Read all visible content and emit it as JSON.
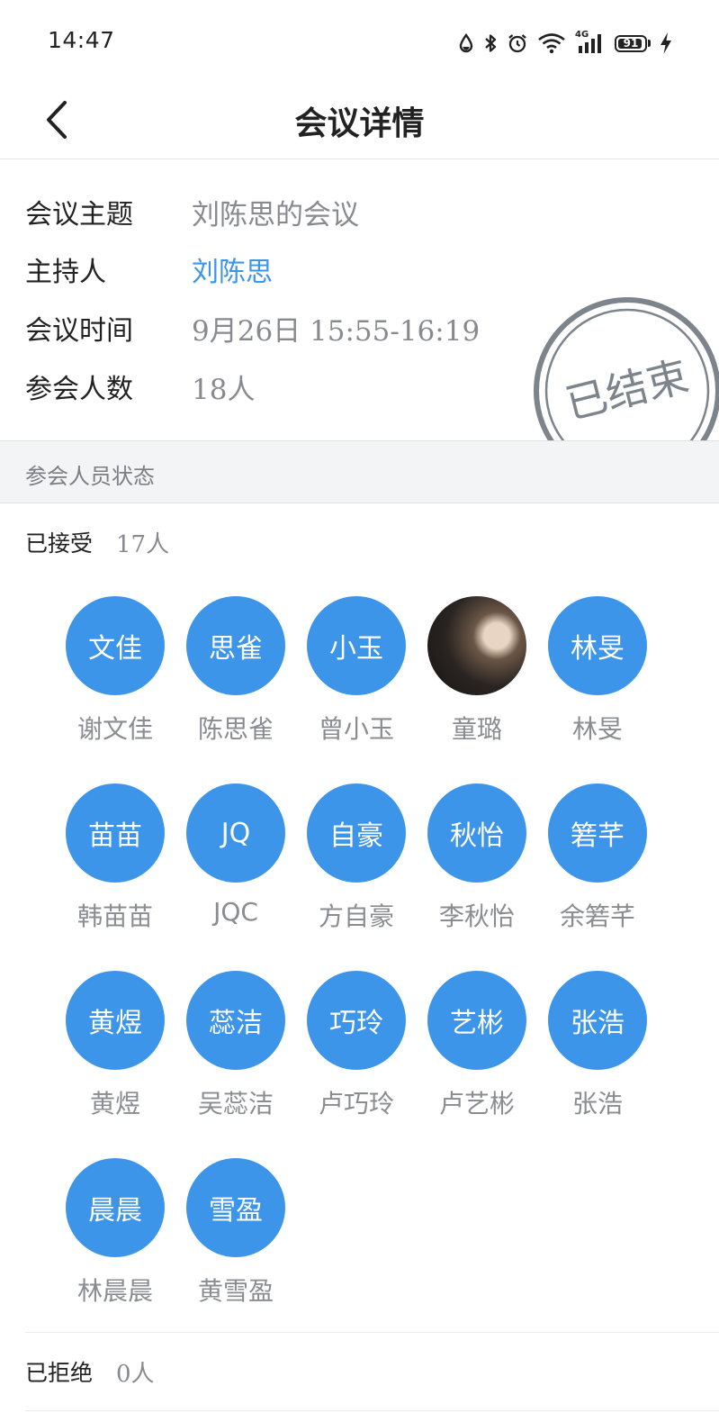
{
  "status_bar": {
    "time": "14:47",
    "network": "4G",
    "battery": "91",
    "icons": [
      "data-saver-icon",
      "bluetooth-icon",
      "alarm-icon",
      "wifi-icon",
      "signal-icon",
      "battery-icon",
      "charging-icon"
    ]
  },
  "nav": {
    "title": "会议详情",
    "back_icon": "chevron-left-icon"
  },
  "meeting": {
    "topic_label": "会议主题",
    "topic": "刘陈思的会议",
    "host_label": "主持人",
    "host": "刘陈思",
    "time_label": "会议时间",
    "time": "9月26日 15:55-16:19",
    "count_label": "参会人数",
    "count": "18人",
    "stamp": "已结束"
  },
  "section_title": "参会人员状态",
  "accepted": {
    "label": "已接受",
    "count": "17人",
    "people": [
      {
        "avatar": "文佳",
        "name": "谢文佳"
      },
      {
        "avatar": "思雀",
        "name": "陈思雀"
      },
      {
        "avatar": "小玉",
        "name": "曾小玉"
      },
      {
        "avatar": "",
        "name": "童璐",
        "photo": true
      },
      {
        "avatar": "林旻",
        "name": "林旻"
      },
      {
        "avatar": "苗苗",
        "name": "韩苗苗"
      },
      {
        "avatar": "JQ",
        "name": "JQC"
      },
      {
        "avatar": "自豪",
        "name": "方自豪"
      },
      {
        "avatar": "秋怡",
        "name": "李秋怡"
      },
      {
        "avatar": "箬芊",
        "name": "余箬芊"
      },
      {
        "avatar": "黄煜",
        "name": "黄煜"
      },
      {
        "avatar": "蕊洁",
        "name": "吴蕊洁"
      },
      {
        "avatar": "巧玲",
        "name": "卢巧玲"
      },
      {
        "avatar": "艺彬",
        "name": "卢艺彬"
      },
      {
        "avatar": "张浩",
        "name": "张浩"
      },
      {
        "avatar": "晨晨",
        "name": "林晨晨"
      },
      {
        "avatar": "雪盈",
        "name": "黄雪盈"
      }
    ]
  },
  "rejected": {
    "label": "已拒绝",
    "count": "0人"
  },
  "colors": {
    "accent": "#3d95ea",
    "muted_text": "#888a90",
    "section_bg": "#f3f4f6",
    "stamp": "#7d848c"
  }
}
